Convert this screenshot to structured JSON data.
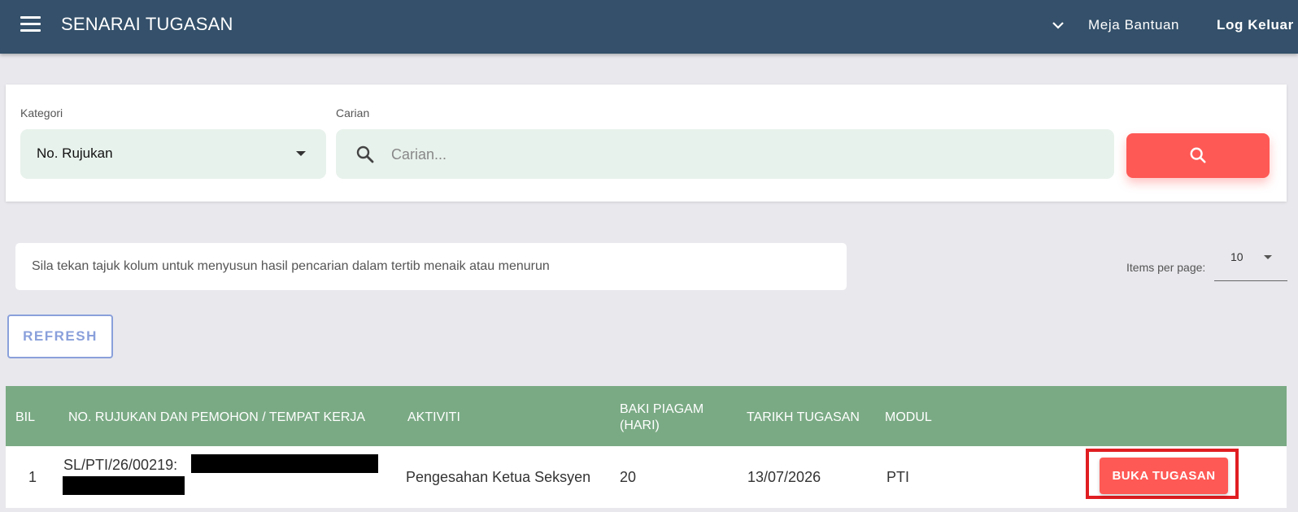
{
  "header": {
    "menu_icon": "hamburger-menu-icon",
    "title": "SENARAI TUGASAN",
    "dropdown_icon": "chevron-down-icon",
    "help_label": "Meja Bantuan",
    "logout_label": "Log Keluar"
  },
  "search": {
    "category_label": "Kategori",
    "category_value": "No. Rujukan",
    "search_label": "Carian",
    "search_placeholder": "Carian...",
    "search_value": "",
    "search_icon": "search-icon"
  },
  "hint": "Sila tekan tajuk kolum untuk menyusun hasil pencarian dalam tertib menaik atau menurun",
  "pagination": {
    "items_per_page_label": "Items per page:",
    "items_per_page_value": "10"
  },
  "refresh_label": "REFRESH",
  "table": {
    "columns": {
      "bil": "BIL",
      "ref": "NO. RUJUKAN DAN PEMOHON / TEMPAT KERJA",
      "activity": "AKTIVITI",
      "baki_line1": "BAKI PIAGAM",
      "baki_line2": "(HARI)",
      "date": "TARIKH TUGASAN",
      "module": "MODUL"
    },
    "rows": [
      {
        "bil": "1",
        "ref": "SL/PTI/26/00219:",
        "activity": "Pengesahan Ketua Seksyen",
        "baki": "20",
        "date": "13/07/2026",
        "module": "PTI",
        "action_label": "BUKA TUGASAN"
      }
    ]
  },
  "colors": {
    "header_bg": "#34506a",
    "accent_red": "#fe5955",
    "table_header_bg": "#7aaa84",
    "field_bg": "#e8f2ec",
    "highlight_border": "#e01e22"
  }
}
